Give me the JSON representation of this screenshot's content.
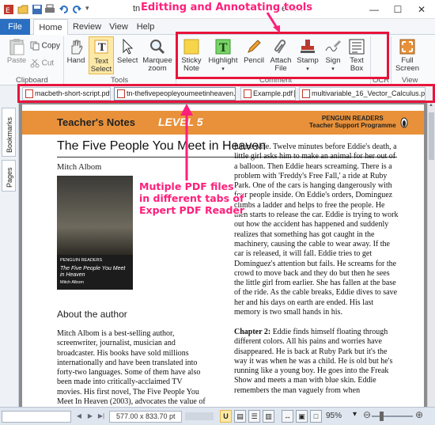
{
  "window": {
    "doc_title": "tn-thefivepeopleyoumeetinheaven.pdf - Expert PDF Reader",
    "doc_title_left": "tn",
    "doc_title_right": "eader",
    "minimize": "—",
    "maximize": "☐",
    "close": "✕"
  },
  "ribbon": {
    "tabs": [
      {
        "label": "File"
      },
      {
        "label": "Home"
      },
      {
        "label": "Review"
      },
      {
        "label": "View"
      },
      {
        "label": "Help"
      }
    ],
    "clipboard": {
      "paste": "Paste",
      "copy": "Copy",
      "cut": "Cut",
      "group": "Clipboard"
    },
    "tools": {
      "hand": "Hand",
      "text_select_1": "Text",
      "text_select_2": "Select",
      "select": "Select",
      "marquee_1": "Marquee",
      "marquee_2": "zoom",
      "group": "Tools"
    },
    "comment": {
      "sticky_1": "Sticky",
      "sticky_2": "Note",
      "highlight": "Highlight",
      "pencil": "Pencil",
      "attach_1": "Attach",
      "attach_2": "File",
      "stamp": "Stamp",
      "sign": "Sign",
      "textbox_1": "Text",
      "textbox_2": "Box",
      "group": "Comment"
    },
    "ocr": {
      "group": "OCR"
    },
    "view": {
      "full_1": "Full",
      "full_2": "Screen",
      "group": "View"
    }
  },
  "doc_tabs": [
    {
      "label": "macbeth-short-script.pdf"
    },
    {
      "label": "tn-thefivepeopleyoumeetinheaven.pdf"
    },
    {
      "label": "Example.pdf"
    },
    {
      "label": "multivariable_16_Vector_Calculus.pdf"
    }
  ],
  "side_tabs": {
    "bookmarks": "Bookmarks",
    "pages": "Pages"
  },
  "page": {
    "teachers_notes": "Teacher's Notes",
    "level": "LEVEL 5",
    "penguin_1": "PENGUIN READERS",
    "penguin_2": "Teacher Support Programme",
    "book_title": "The Five People You Meet in Heaven",
    "author": "Mitch Albom",
    "cover_publisher": "PENGUIN READERS",
    "cover_title": "The Five People You Meet in Heaven",
    "cover_author": "Mitch Albom",
    "about_heading": "About the author",
    "left_col": "Mitch Albom is a best-selling author, screenwriter, journalist, musician and broadcaster. His books have sold millions internationally and have been translated into forty-two languages. Some of them have also been made into critically-acclaimed TV movies. His first novel, The Five People You Meet In Heaven (2003), advocates the value of love and human life, before and after death. These themes run",
    "right_col": "future wife. Twelve minutes before Eddie's death, a little girl asks him to make an animal for her out of a balloon. Then Eddie hears screaming. There is a problem with 'Freddy's Free Fall,' a ride at Ruby Park. One of the cars is hanging dangerously with four people inside. On Eddie's orders, Dominguez climbs a ladder and helps to free the people. He then starts to release the car. Eddie is trying to work out how the accident has happened and suddenly realizes that something has got caught in the machinery, causing the cable to wear away. If the car is released, it will fall. Eddie tries to get Dominguez's attention but fails. He screams for the crowd to move back and they do but then he sees the little girl from earlier. She has fallen at the base of the ride. As the cable breaks, Eddie dives to save her and his days on earth are ended. His last memory is two small hands in his.",
    "chapter_label": "Chapter 2:",
    "right_col2": "Eddie finds himself floating through different colors. All his pains and worries have disappeared. He is back at Ruby Park but it's the way it was when he was a child. He is old but he's running like a young boy. He goes into the Freak Show and meets a man with blue skin. Eddie remembers the man vaguely from when"
  },
  "status": {
    "dims": "577.00 x 833.70 pt",
    "zoom": "95%"
  },
  "annotations": {
    "tools_label": "Editting and Annotating tools",
    "tabs_line1": "Mutiple PDF files",
    "tabs_line2": "in different tabs of",
    "tabs_line3": "Expert PDF Reader"
  },
  "colors": {
    "accent": "#2a6fc2",
    "header_orange": "#e8913a",
    "annotation_pink": "#ff1f7a",
    "annotation_red": "#e8143a"
  }
}
